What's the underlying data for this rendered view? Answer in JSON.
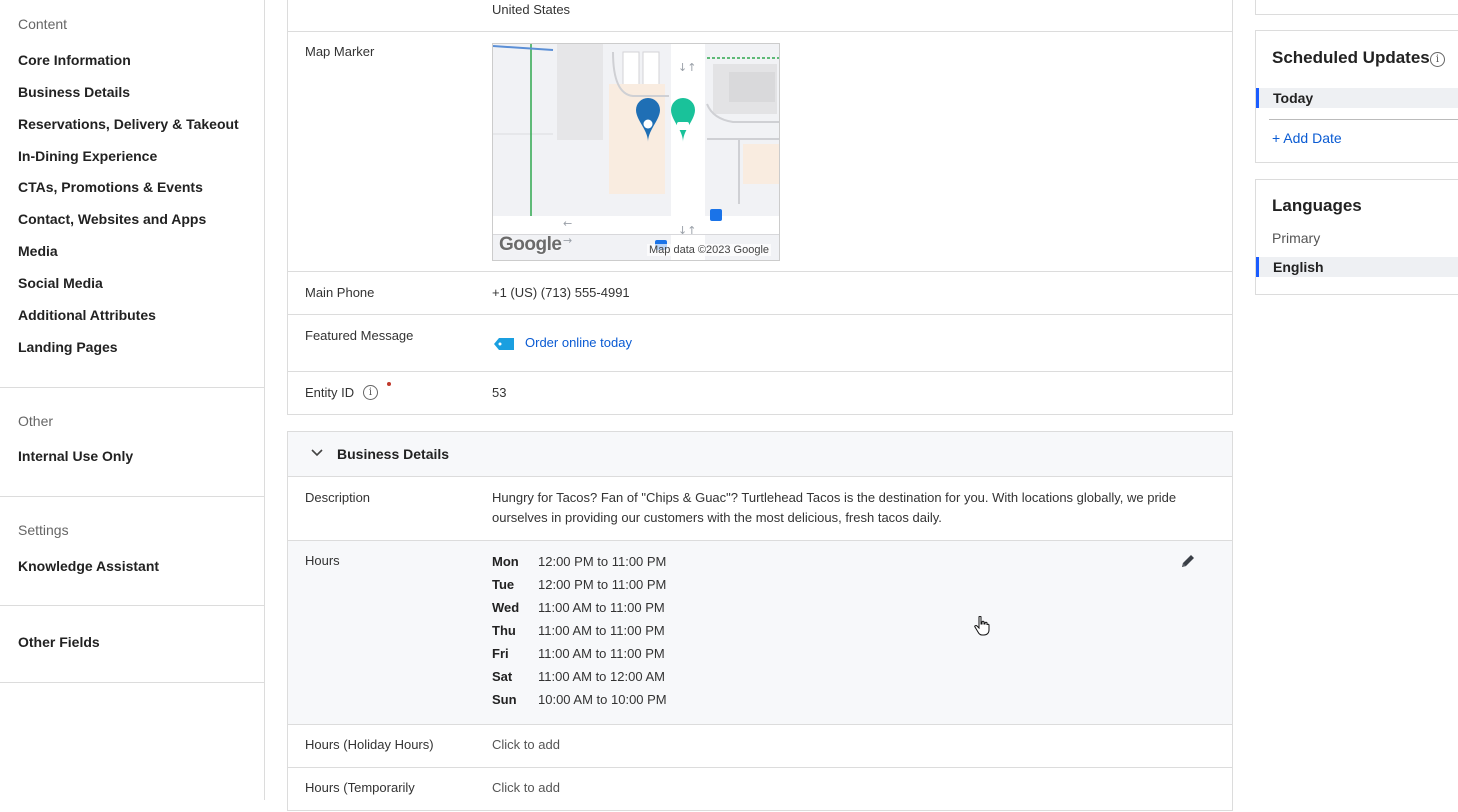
{
  "sidebar": {
    "content_heading": "Content",
    "content_items": [
      "Core Information",
      "Business Details",
      "Reservations, Delivery & Takeout",
      "In-Dining Experience",
      "CTAs, Promotions & Events",
      "Contact, Websites and Apps",
      "Media",
      "Social Media",
      "Additional Attributes",
      "Landing Pages"
    ],
    "other_heading": "Other",
    "other_items": [
      "Internal Use Only"
    ],
    "settings_heading": "Settings",
    "settings_items": [
      "Knowledge Assistant"
    ],
    "other_fields": "Other Fields"
  },
  "core": {
    "country": "United States",
    "map_marker_label": "Map Marker",
    "map_attribution": "Map data ©2023 Google",
    "map_logo": "Google",
    "main_phone_label": "Main Phone",
    "main_phone_value": "+1 (US) (713) 555-4991",
    "featured_message_label": "Featured Message",
    "featured_message_value": "Order online today",
    "entity_id_label": "Entity ID",
    "entity_id_value": "53"
  },
  "business_details": {
    "title": "Business Details",
    "description_label": "Description",
    "description_line1": "Hungry for Tacos? Fan of \"Chips & Guac\"? Turtlehead Tacos is the destination for you. With locations globally, we pride",
    "description_line2": "ourselves in providing our customers with the most delicious, fresh tacos daily.",
    "hours_label": "Hours",
    "hours": [
      {
        "day": "Mon",
        "time": "12:00 PM to 11:00 PM"
      },
      {
        "day": "Tue",
        "time": "12:00 PM to 11:00 PM"
      },
      {
        "day": "Wed",
        "time": "11:00 AM to 11:00 PM"
      },
      {
        "day": "Thu",
        "time": "11:00 AM to 11:00 PM"
      },
      {
        "day": "Fri",
        "time": "11:00 AM to 11:00 PM"
      },
      {
        "day": "Sat",
        "time": "11:00 AM to 12:00 AM"
      },
      {
        "day": "Sun",
        "time": "10:00 AM to 10:00 PM"
      }
    ],
    "holiday_hours_label": "Hours (Holiday Hours)",
    "holiday_hours_value": "Click to add",
    "temp_hours_label": "Hours (Temporarily",
    "temp_hours_value": "Click to add"
  },
  "right_panel": {
    "scheduled_updates_title": "Scheduled Updates",
    "scheduled_selected": "Today",
    "add_date": "+ Add Date",
    "languages_title": "Languages",
    "primary_label": "Primary",
    "language_selected": "English"
  },
  "colors": {
    "accent": "#1a5cff",
    "link": "#0a5bd3",
    "marker_blue": "#1f6fb5",
    "marker_teal": "#19c29a"
  }
}
